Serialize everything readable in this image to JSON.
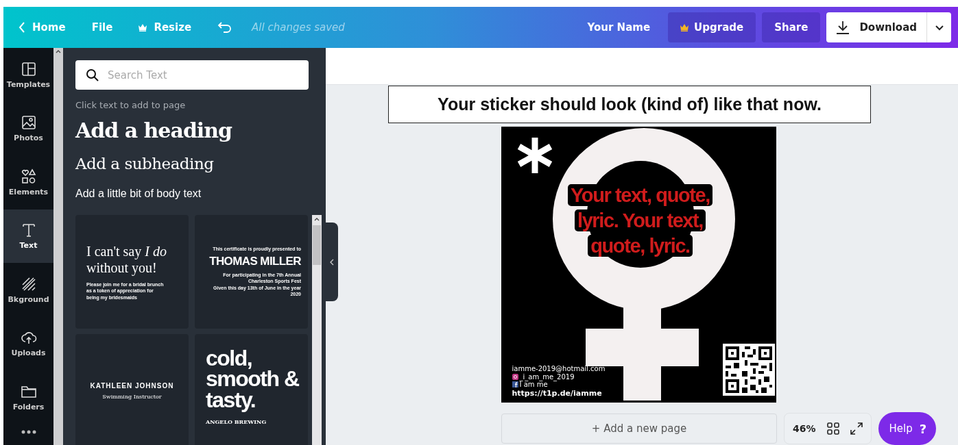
{
  "top_bar": {
    "home": "Home",
    "file": "File",
    "resize": "Resize",
    "save_status": "All changes saved",
    "user_name": "Your Name",
    "upgrade": "Upgrade",
    "share": "Share",
    "download": "Download"
  },
  "sidebar": {
    "items": [
      {
        "label": "Templates",
        "selected": false
      },
      {
        "label": "Photos",
        "selected": false
      },
      {
        "label": "Elements",
        "selected": false
      },
      {
        "label": "Text",
        "selected": true
      },
      {
        "label": "Bkground",
        "selected": false
      },
      {
        "label": "Uploads",
        "selected": false
      },
      {
        "label": "Folders",
        "selected": false
      }
    ]
  },
  "text_panel": {
    "search": {
      "placeholder": "Search Text"
    },
    "hint": "Click text to add to page",
    "heading": "Add a heading",
    "subheading": "Add a subheading",
    "body": "Add a little bit of body text",
    "templates": [
      {
        "kind": "script",
        "title": "I can't say *I do* without you!",
        "lines": [
          "Please join me for a bridal brunch",
          "as a token of appreciation for",
          "being my bridesmaids"
        ]
      },
      {
        "kind": "certificate",
        "pre": "This certificate is proudly presented to",
        "title": "THOMAS MILLER",
        "lines": [
          "For participating in the 7th Annual Charleston Sports Fest",
          "Given this day 13th of June in the year 2020"
        ]
      },
      {
        "kind": "name",
        "title": "KATHLEEN JOHNSON",
        "lines": [
          "Swimming Instructor"
        ]
      },
      {
        "kind": "brand",
        "title": "cold, smooth & tasty.",
        "lines": [
          "ANGELO BREWING"
        ]
      }
    ]
  },
  "canvas": {
    "caption": "Your sticker should look (kind of) like that now.",
    "design": {
      "headline": "Your text, quote, lyric. Your text, quote, lyric.",
      "email": "iamme-2019@hotmail.com",
      "instagram": "_i_am_me_2019",
      "facebook": "I am me",
      "url": "https://t1p.de/iamme"
    },
    "add_page": "+ Add a new page",
    "zoom": "46%",
    "help": "Help",
    "help_icon": "?"
  }
}
